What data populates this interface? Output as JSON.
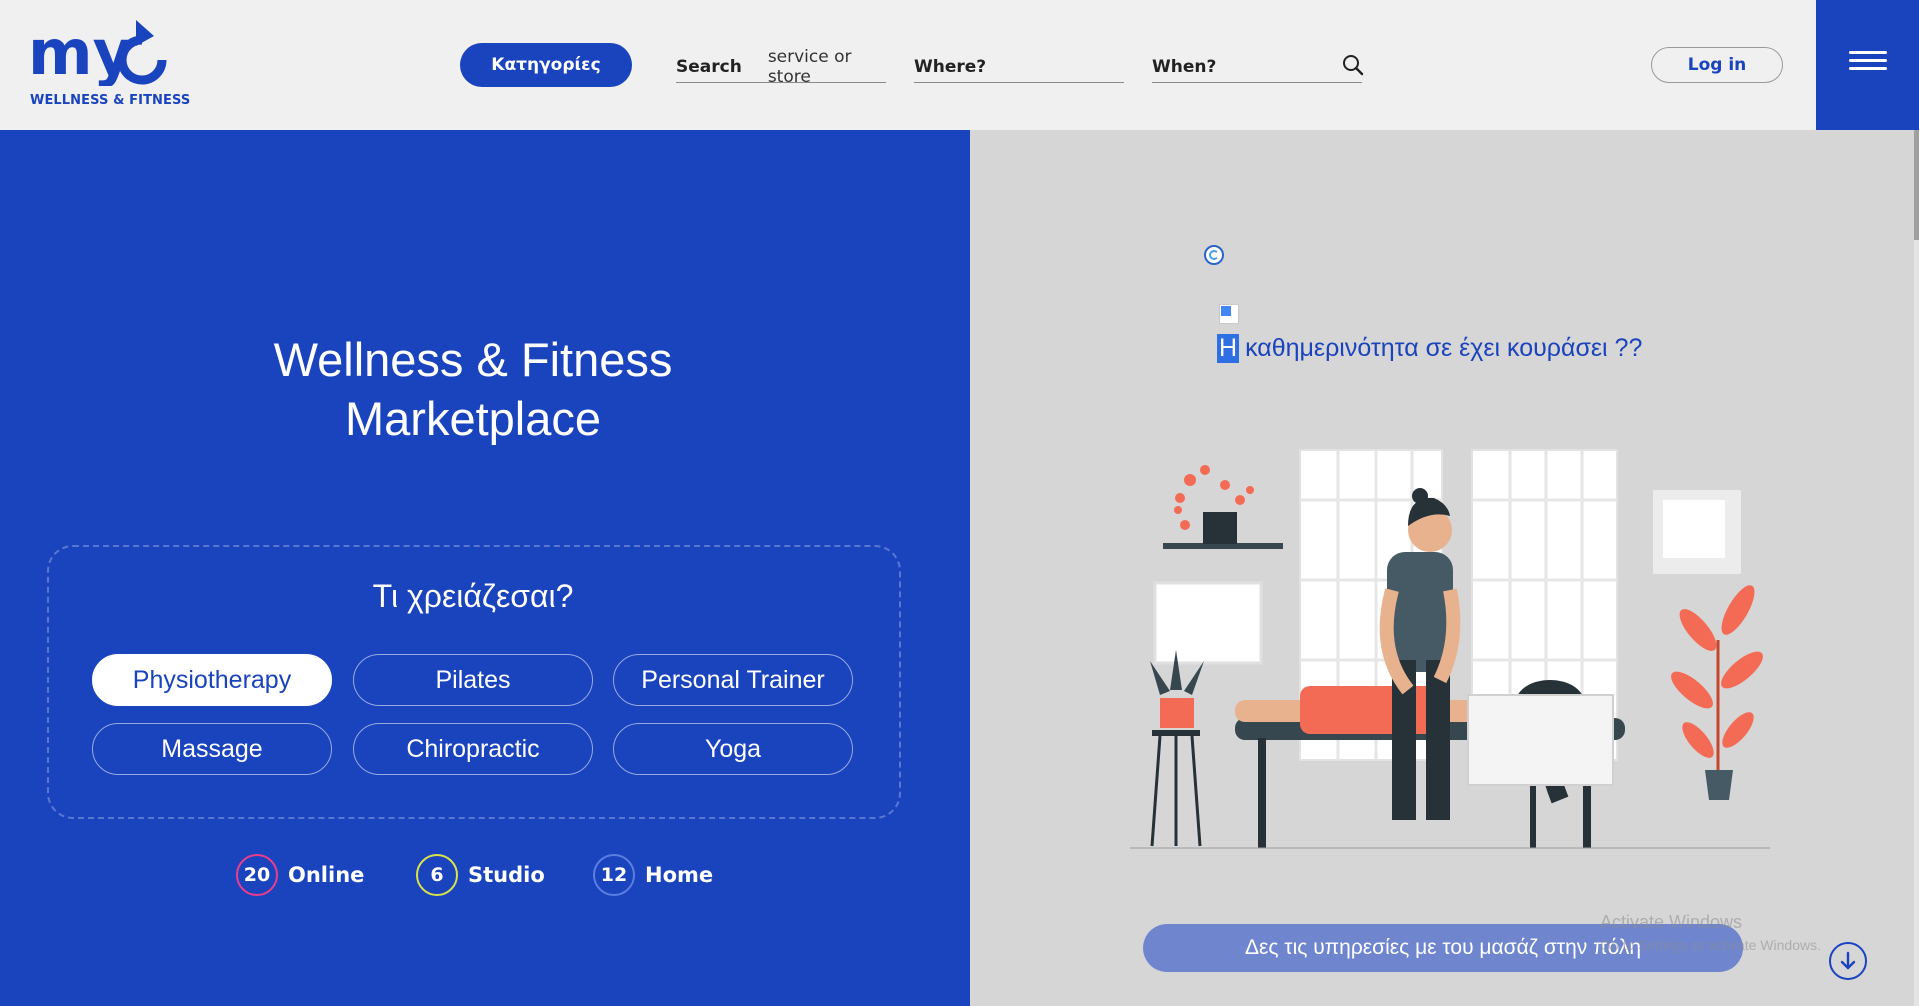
{
  "brand": {
    "logo_text": "my",
    "tagline": "WELLNESS & FITNESS",
    "primary_color": "#1a43be",
    "right_bg": "#d6d6d6",
    "header_bg": "#f0f0f0"
  },
  "header": {
    "categories_label": "Κατηγορίες",
    "search": {
      "what_label": "Search",
      "what_value": "service or store",
      "where_label": "Where?",
      "when_label": "When?"
    },
    "login_label": "Log in",
    "menu_icon": "hamburger-icon"
  },
  "hero": {
    "title_line1": "Wellness & Fitness",
    "title_line2": "Marketplace",
    "question": "Τι χρειάζεσαι?",
    "services": [
      {
        "label": "Physiotherapy",
        "selected": true
      },
      {
        "label": "Pilates",
        "selected": false
      },
      {
        "label": "Personal Trainer",
        "selected": false
      },
      {
        "label": "Massage",
        "selected": false
      },
      {
        "label": "Chiropractic",
        "selected": false
      },
      {
        "label": "Yoga",
        "selected": false
      }
    ],
    "counts": [
      {
        "count": "20",
        "label": "Online",
        "ring_color": "#e83e8c"
      },
      {
        "count": "6",
        "label": "Studio",
        "ring_color": "#d9e24a"
      },
      {
        "count": "12",
        "label": "Home",
        "ring_color": "#5b7fe0"
      }
    ]
  },
  "promo": {
    "tagline_first_letter": "Η",
    "tagline_rest": "καθημερινότητα σε έχει κουράσει ??",
    "cta_label": "Δες τις υπηρεσίες με του μασάζ στην πόλη",
    "illustration": "massage-illustration",
    "scroll_icon": "arrow-down-circle-icon"
  },
  "os_watermark": {
    "title": "Activate Windows",
    "subtitle": "Go to Settings to activate Windows."
  }
}
